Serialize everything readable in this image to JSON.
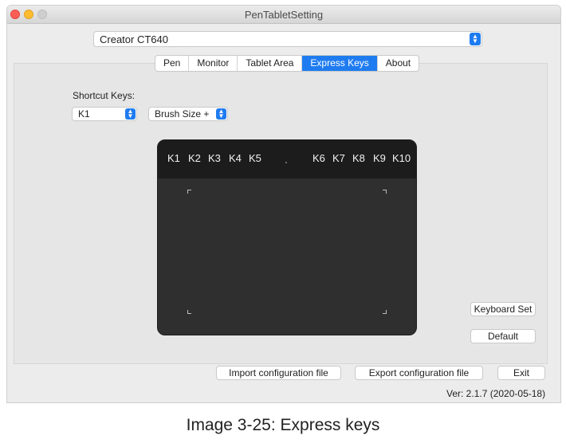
{
  "window": {
    "title": "PenTabletSetting"
  },
  "device": {
    "selected": "Creator CT640"
  },
  "tabs": [
    {
      "label": "Pen"
    },
    {
      "label": "Monitor"
    },
    {
      "label": "Tablet Area"
    },
    {
      "label": "Express Keys",
      "active": true
    },
    {
      "label": "About"
    }
  ],
  "shortcut": {
    "label": "Shortcut Keys:",
    "key_selected": "K1",
    "function_selected": "Brush Size +"
  },
  "tablet": {
    "keys": [
      "K1",
      "K2",
      "K3",
      "K4",
      "K5",
      "K6",
      "K7",
      "K8",
      "K9",
      "K10"
    ]
  },
  "buttons": {
    "keyboard_set": "Keyboard Set",
    "default": "Default",
    "import": "Import configuration file",
    "export": "Export configuration file",
    "exit": "Exit"
  },
  "version": "Ver: 2.1.7 (2020-05-18)",
  "caption": "Image 3-25: Express keys",
  "colors": {
    "accent": "#1f7cf0",
    "tablet_body": "#2f2f2f",
    "key_strip": "#1c1c1c"
  }
}
